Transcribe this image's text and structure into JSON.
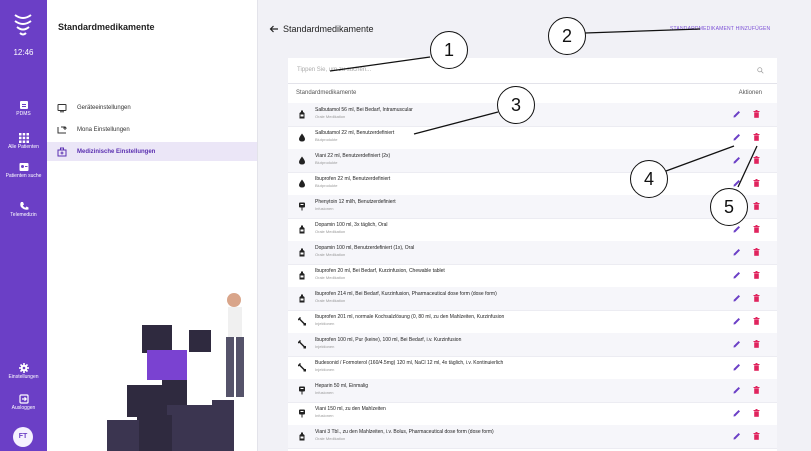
{
  "rail": {
    "time": "12:46",
    "items": [
      {
        "label": "PDMS",
        "icon": "clipboard-icon"
      },
      {
        "label": "Alle Patienten",
        "icon": "grid-icon"
      },
      {
        "label": "Patienten suche",
        "icon": "patient-search-icon"
      },
      {
        "label": "Telemedizin",
        "icon": "phone-icon"
      },
      {
        "label": "Einstellungen",
        "icon": "gear-icon"
      },
      {
        "label": "Ausloggen",
        "icon": "logout-icon"
      }
    ],
    "avatar": "FT",
    "color": "#6b3fc6"
  },
  "panel": {
    "title": "Standardmedikamente",
    "menu": [
      {
        "label": "Geräteeinstellungen",
        "icon": "device-icon",
        "active": false
      },
      {
        "label": "Mona Einstellungen",
        "icon": "mona-icon",
        "active": false
      },
      {
        "label": "Medizinische Einstellungen",
        "icon": "medical-icon",
        "active": true
      }
    ]
  },
  "main": {
    "title": "Standardmedikamente",
    "add_button": "STANDARDMEDIKAMENT HINZUFÜGEN",
    "search_placeholder": "Tippen Sie, um zu suchen...",
    "col_name": "Standardmedikamente",
    "col_actions": "Aktionen",
    "rows": [
      {
        "name": "Salbutamol 56 ml, Bei Bedarf, Intramuscular",
        "type": "Orale Medikation",
        "icon": "bottle"
      },
      {
        "name": "Salbutamol 22 ml, Benutzerdefiniert",
        "type": "Blutprodukte",
        "icon": "drop"
      },
      {
        "name": "Viani 22 ml, Benutzerdefiniert (2x)",
        "type": "Blutprodukte",
        "icon": "drop"
      },
      {
        "name": "Ibuprofen 22 ml, Benutzerdefiniert",
        "type": "Blutprodukte",
        "icon": "drop"
      },
      {
        "name": "Phenytoin 12 ml/h, Benutzerdefiniert",
        "type": "Infusionen",
        "icon": "infusion"
      },
      {
        "name": "Dopamin 100 ml, 3x täglich, Oral",
        "type": "Orale Medikation",
        "icon": "bottle"
      },
      {
        "name": "Dopamin 100 ml, Benutzerdefiniert (1x), Oral",
        "type": "Orale Medikation",
        "icon": "bottle"
      },
      {
        "name": "Ibuprofen 20 ml, Bei Bedarf, Kurzinfusion, Chewable tablet",
        "type": "Orale Medikation",
        "icon": "bottle"
      },
      {
        "name": "Ibuprofen 214 ml, Bei Bedarf, Kurzinfusion, Pharmaceutical dose form (dose form)",
        "type": "Orale Medikation",
        "icon": "bottle"
      },
      {
        "name": "Ibuprofen 201 ml, normale Kochsalzlösung (0, 80 ml, zu den Mahlzeiten, Kurzinfusion",
        "type": "Injektionen",
        "icon": "syringe"
      },
      {
        "name": "Ibuprofen 100 ml, Pur (keine), 100 ml, Bei Bedarf, i.v. Kurzinfusion",
        "type": "Injektionen",
        "icon": "syringe"
      },
      {
        "name": "Budesonid / Formoterol (160/4.5mg) 120 ml, NaCl 12 ml, 4x täglich, i.v. Kontinuierlich",
        "type": "Injektionen",
        "icon": "syringe"
      },
      {
        "name": "Heparin 50 ml, Einmalig",
        "type": "Infusionen",
        "icon": "infusion"
      },
      {
        "name": "Viani 150 ml, zu den Mahlzeiten",
        "type": "Infusionen",
        "icon": "infusion"
      },
      {
        "name": "Viani 3 Tbl., zu den Mahlzeiten, i.v. Bolus, Pharmaceutical dose form (dose form)",
        "type": "Orale Medikation",
        "icon": "bottle"
      }
    ]
  },
  "callouts": [
    "1",
    "2",
    "3",
    "4",
    "5"
  ],
  "colors": {
    "accent": "#7b4fd6",
    "delete": "#e0245e",
    "edit": "#6b3fc6"
  }
}
